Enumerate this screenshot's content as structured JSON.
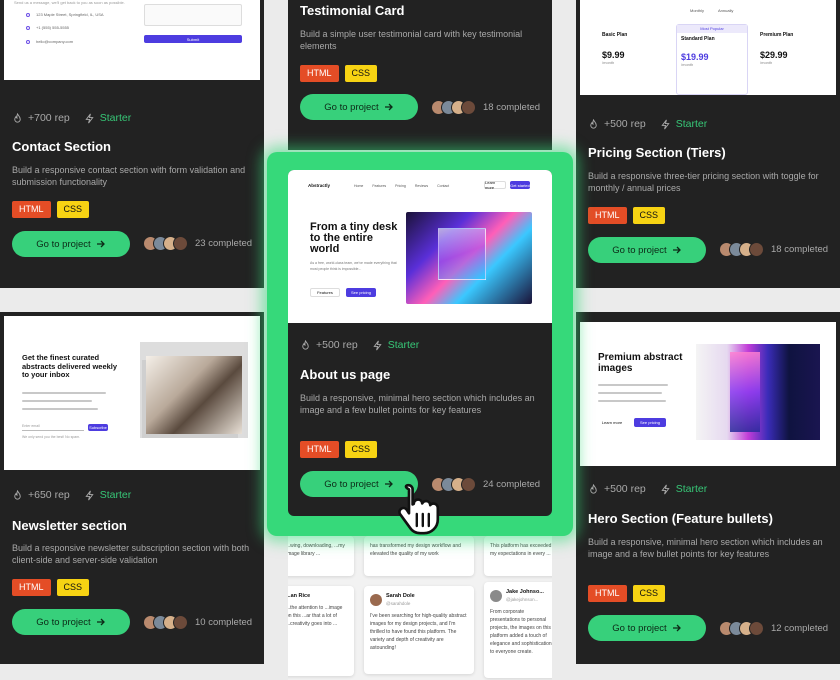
{
  "cards": {
    "contact": {
      "thumb_lines": [
        "123 Maple Street, Springfield, IL, USA",
        "+1 (555) 555-5555",
        "hello@company.com"
      ],
      "submit": "Submit",
      "rep": "+700 rep",
      "level": "Starter",
      "title": "Contact Section",
      "desc": "Build a responsive contact section with form validation and submission functionality",
      "completed": "23 completed"
    },
    "testimonial": {
      "title": "Testimonial Card",
      "desc": "Build a simple user testimonial card with key testimonial elements",
      "completed": "18 completed"
    },
    "pricing": {
      "thumb": {
        "toggle": [
          "Monthly",
          "Annually"
        ],
        "popular": "Most Popular",
        "plans": [
          {
            "name": "Basic Plan",
            "price": "$9.99",
            "per": "/month"
          },
          {
            "name": "Standard Plan",
            "price": "$19.99",
            "per": "/month"
          },
          {
            "name": "Premium Plan",
            "price": "$29.99",
            "per": "/month"
          }
        ]
      },
      "rep": "+500 rep",
      "level": "Starter",
      "title": "Pricing Section (Tiers)",
      "desc": "Build a responsive three-tier pricing section with toggle for monthly / annual prices",
      "completed": "18 completed"
    },
    "about": {
      "thumb": {
        "brand": "Abstractly",
        "nav": [
          "Home",
          "Features",
          "Pricing",
          "Reviews",
          "Contact"
        ],
        "login": "Learn more",
        "signup": "Get started",
        "headline": "From a tiny desk to the entire world",
        "body": "As a free, world-class team, we've made everything that most people think is impossible...",
        "btn1": "Features",
        "btn2": "See pricing"
      },
      "rep": "+500 rep",
      "level": "Starter",
      "title": "About us page",
      "desc": "Build a responsive, minimal hero section which includes an image and a few bullet points for key features",
      "completed": "24 completed"
    },
    "newsletter": {
      "thumb": {
        "headline": "Get the finest curated abstracts delivered weekly to your inbox",
        "placeholder": "Enter email",
        "subscribe": "Subscribe",
        "note": "We only send you the best! No spam."
      },
      "rep": "+650 rep",
      "level": "Starter",
      "title": "Newsletter section",
      "desc": "Build a responsive newsletter subscription section with both client-side and server-side validation",
      "completed": "10 completed"
    },
    "hero": {
      "thumb": {
        "headline": "Premium abstract images",
        "btn1": "Learn more",
        "btn2": "See pricing"
      },
      "rep": "+500 rep",
      "level": "Starter",
      "title": "Hero Section (Feature bullets)",
      "desc": "Build a responsive, minimal hero section which includes an image and a few bullet points for key features",
      "completed": "12 completed"
    }
  },
  "tags": {
    "html": "HTML",
    "css": "CSS"
  },
  "cta": "Go to project",
  "reviews": [
    {
      "text": "...wing, downloading, ...my image library ..."
    },
    {
      "text": "has transformed my design workflow and elevated the quality of my work"
    },
    {
      "text": "This platform has exceeded my expectations in every ..."
    },
    {
      "name": "...an Rice",
      "text": "...the attention to ...image on this ...ar that a lot of ...creativity goes into ..."
    },
    {
      "name": "Sarah Dole",
      "handle": "@sarahdole",
      "text": "I've been searching for high-quality abstract images for my design projects, and I'm thrilled to have found this platform. The variety and depth of creativity are astounding!"
    },
    {
      "name": "Jake Johnso...",
      "handle": "@jakejohnson...",
      "text": "From corporate presentations to personal projects, the images on this platform added a touch of elegance and sophistication to everyone create."
    }
  ],
  "colors": {
    "card": "#222222",
    "accent": "#37d07b",
    "html_tag": "#e44d26",
    "css_tag": "#f7d313",
    "highlight": "#36d97a"
  }
}
